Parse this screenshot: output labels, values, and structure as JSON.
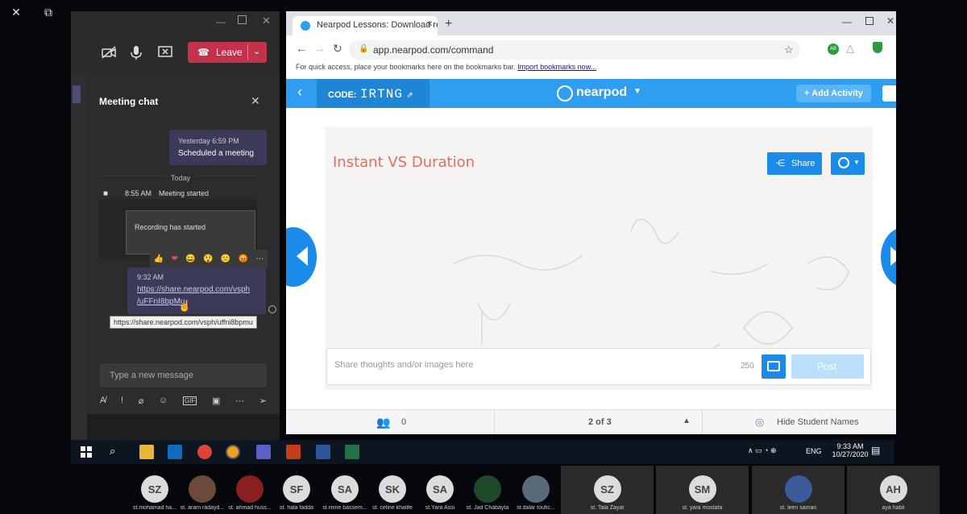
{
  "outer": {
    "close_glyph": "✕",
    "restore_glyph": "⧉",
    "minimize_glyph": "—"
  },
  "teams": {
    "leave_label": "Leave",
    "chat_title": "Meeting chat",
    "messages": [
      {
        "time": "Yesterday 6:59 PM",
        "text": "Scheduled a meeting"
      },
      {
        "time": "9:32 AM",
        "link_line1": "https://share.nearpod.com/vsph",
        "link_line2": "/uFFnI8bpMu"
      }
    ],
    "today_label": "Today",
    "meeting_started_time": "8:55 AM",
    "meeting_started_text": "Meeting started",
    "recording_text": "Recording has started",
    "reactions": [
      "👍",
      "❤",
      "😄",
      "😲",
      "🙁",
      "😡",
      "⋯"
    ],
    "tooltip": "https://share.nearpod.com/vsph/uffni8bpmu",
    "compose_placeholder": "Type a new message"
  },
  "browser": {
    "tab_title": "Nearpod Lessons: Download rea",
    "new_tab": "+",
    "url": "app.nearpod.com/command",
    "bookmarks_text": "For quick access, place your bookmarks here on the bookmarks bar.",
    "bookmarks_link": "Import bookmarks now..."
  },
  "nearpod": {
    "code_label": "CODE:",
    "code_value": "IRTNG",
    "logo_text": "nearpod",
    "add_activity": "+ Add Activity",
    "slide_title": "Instant VS Duration",
    "share_label": "Share",
    "post_placeholder": "Share thoughts and/or images here",
    "char_count": "250",
    "post_label": "Post",
    "students_count": "0",
    "page_indicator": "2 of 3",
    "hide_names": "Hide Student Names"
  },
  "taskbar": {
    "lang": "ENG",
    "time": "9:33 AM",
    "date": "10/27/2020"
  },
  "participants": [
    {
      "initials": "SZ",
      "name": "st.mohamad ha...",
      "type": "initials"
    },
    {
      "initials": "",
      "name": "st. aram radayd...",
      "type": "photo",
      "color": "#6b4a3a"
    },
    {
      "initials": "",
      "name": "st. ahmad huss...",
      "type": "photo",
      "color": "#8a1f22"
    },
    {
      "initials": "SF",
      "name": "st. hala fadda",
      "type": "initials"
    },
    {
      "initials": "SA",
      "name": "st.reine bassem...",
      "type": "initials"
    },
    {
      "initials": "SK",
      "name": "st. celine khalife",
      "type": "initials"
    },
    {
      "initials": "SA",
      "name": "st.Yara Assi",
      "type": "initials"
    },
    {
      "initials": "",
      "name": "st. Jad Chabayta",
      "type": "photo",
      "color": "#1f4a2a"
    },
    {
      "initials": "",
      "name": "st.dalar toufic...",
      "type": "photo",
      "color": "#5a6a7a"
    },
    {
      "initials": "SZ",
      "name": "st. Tala Zayat",
      "type": "initials"
    },
    {
      "initials": "SM",
      "name": "st. yara mostafa",
      "type": "initials"
    },
    {
      "initials": "",
      "name": "st. leen saman",
      "type": "photo",
      "color": "#3a5a9a"
    },
    {
      "initials": "AH",
      "name": "aya habli",
      "type": "initials"
    }
  ]
}
